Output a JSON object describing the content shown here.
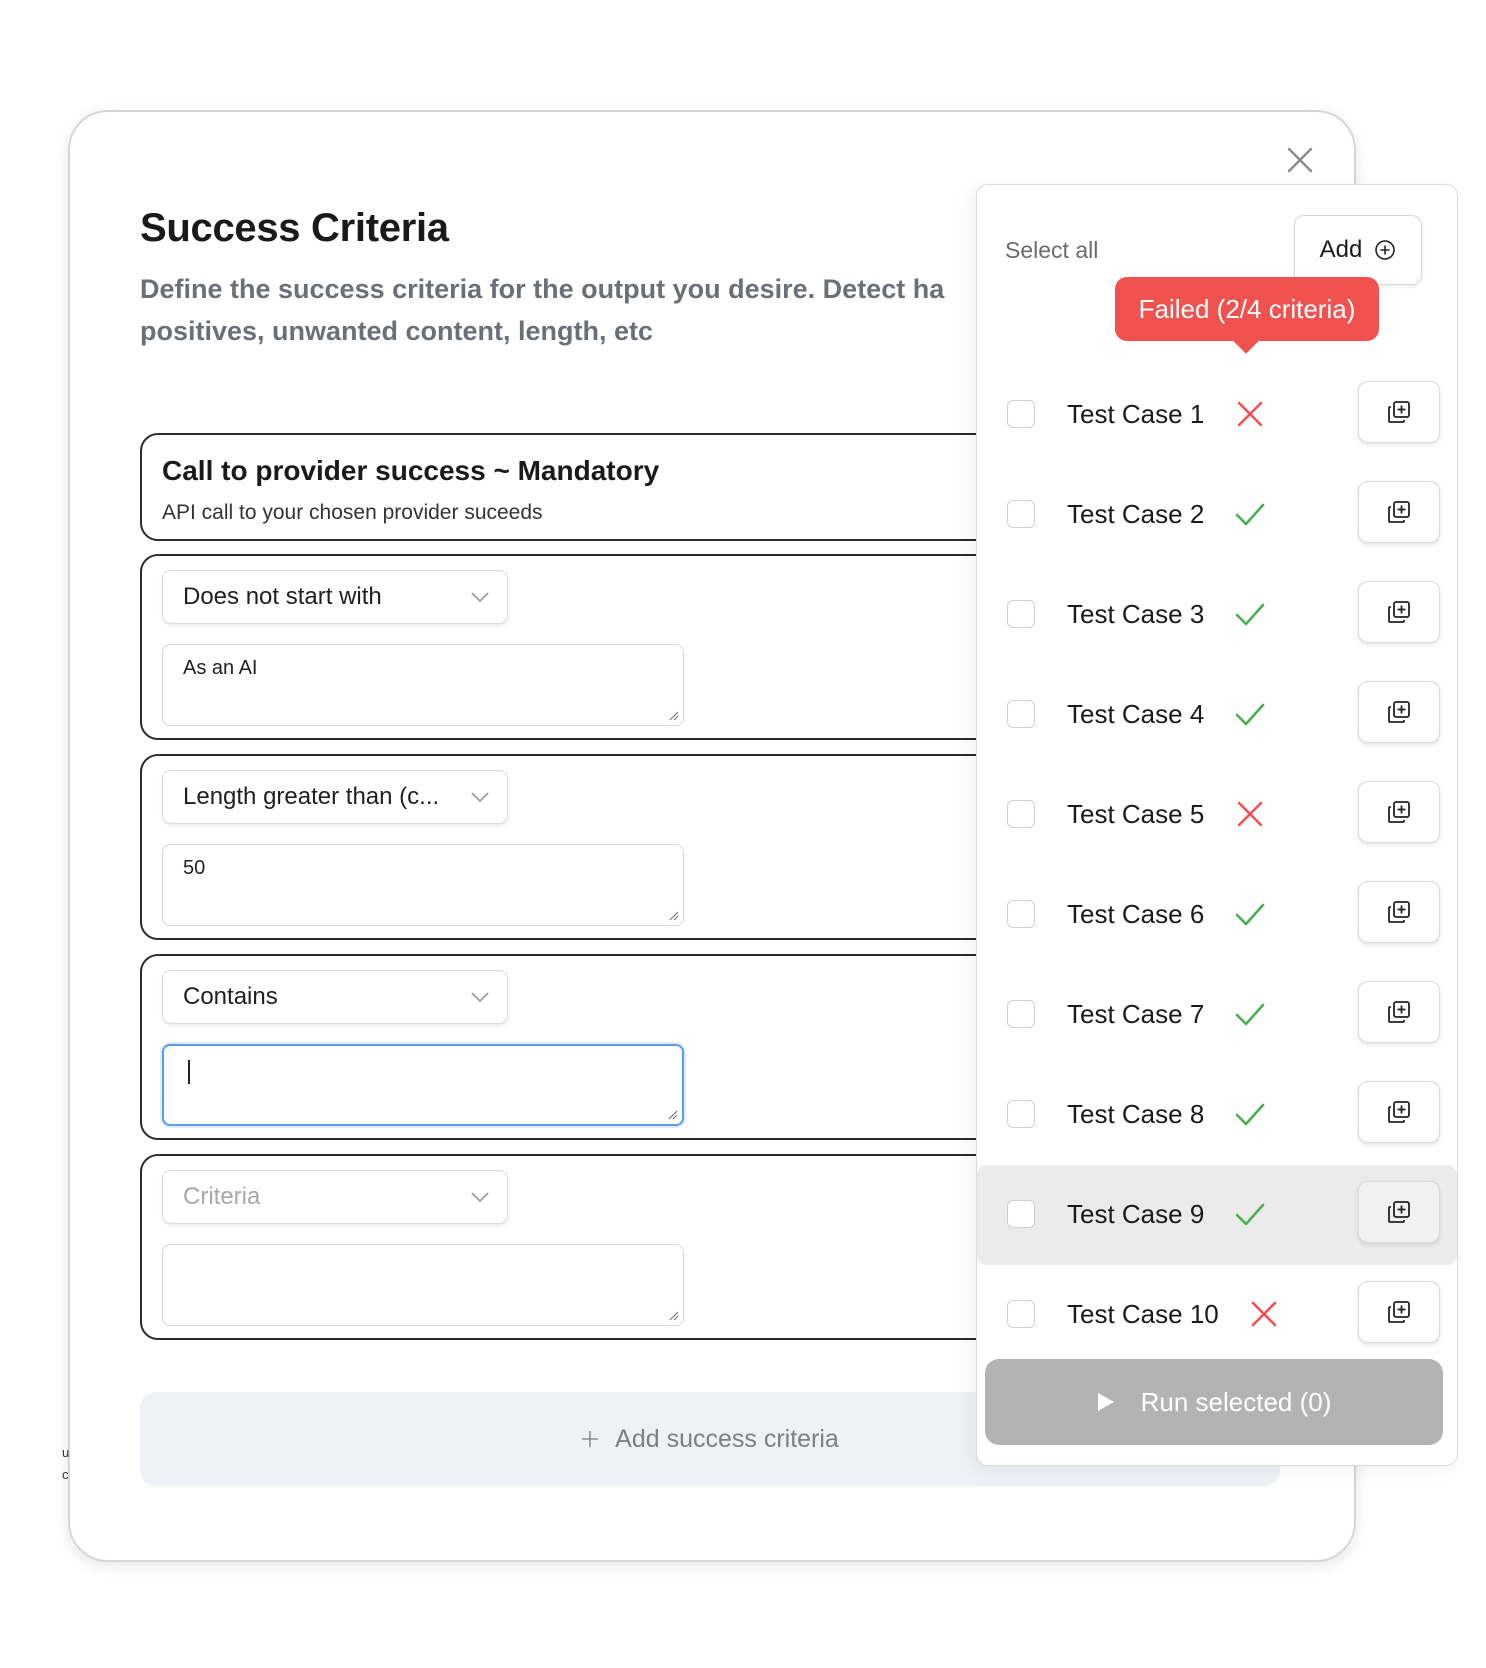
{
  "modal": {
    "title": "Success Criteria",
    "subtitle_line1": "Define the success criteria for the output you desire. Detect ha",
    "subtitle_line2": "positives, unwanted content, length, etc"
  },
  "mandatory": {
    "title": "Call to provider success ~ Mandatory",
    "description": "API call to your chosen provider suceeds"
  },
  "criteria": [
    {
      "select": "Does not start with",
      "value": "As an AI",
      "placeholder": ""
    },
    {
      "select": "Length greater than (c...",
      "value": "50",
      "placeholder": ""
    },
    {
      "select": "Contains",
      "value": "",
      "placeholder": "",
      "focused": true
    },
    {
      "select": "Criteria",
      "value": "",
      "placeholder": ""
    }
  ],
  "add_criteria": {
    "label": "Add success criteria",
    "icon": "plus-icon"
  },
  "panel": {
    "select_all": "Select all",
    "add_label": "Add",
    "add_icon": "plus-circle-icon",
    "tooltip": "Failed (2/4 criteria)",
    "test_cases": [
      {
        "label": "Test Case 1",
        "status": "fail"
      },
      {
        "label": "Test Case 2",
        "status": "pass"
      },
      {
        "label": "Test Case 3",
        "status": "pass"
      },
      {
        "label": "Test Case 4",
        "status": "pass"
      },
      {
        "label": "Test Case 5",
        "status": "fail"
      },
      {
        "label": "Test Case 6",
        "status": "pass"
      },
      {
        "label": "Test Case 7",
        "status": "pass"
      },
      {
        "label": "Test Case 8",
        "status": "pass"
      },
      {
        "label": "Test Case 9",
        "status": "pass",
        "hover": true
      },
      {
        "label": "Test Case 10",
        "status": "fail"
      }
    ],
    "run_label": "Run selected (0)"
  },
  "colors": {
    "fail": "#f0524f",
    "pass": "#4caf50",
    "focus": "#5b9bf0"
  }
}
